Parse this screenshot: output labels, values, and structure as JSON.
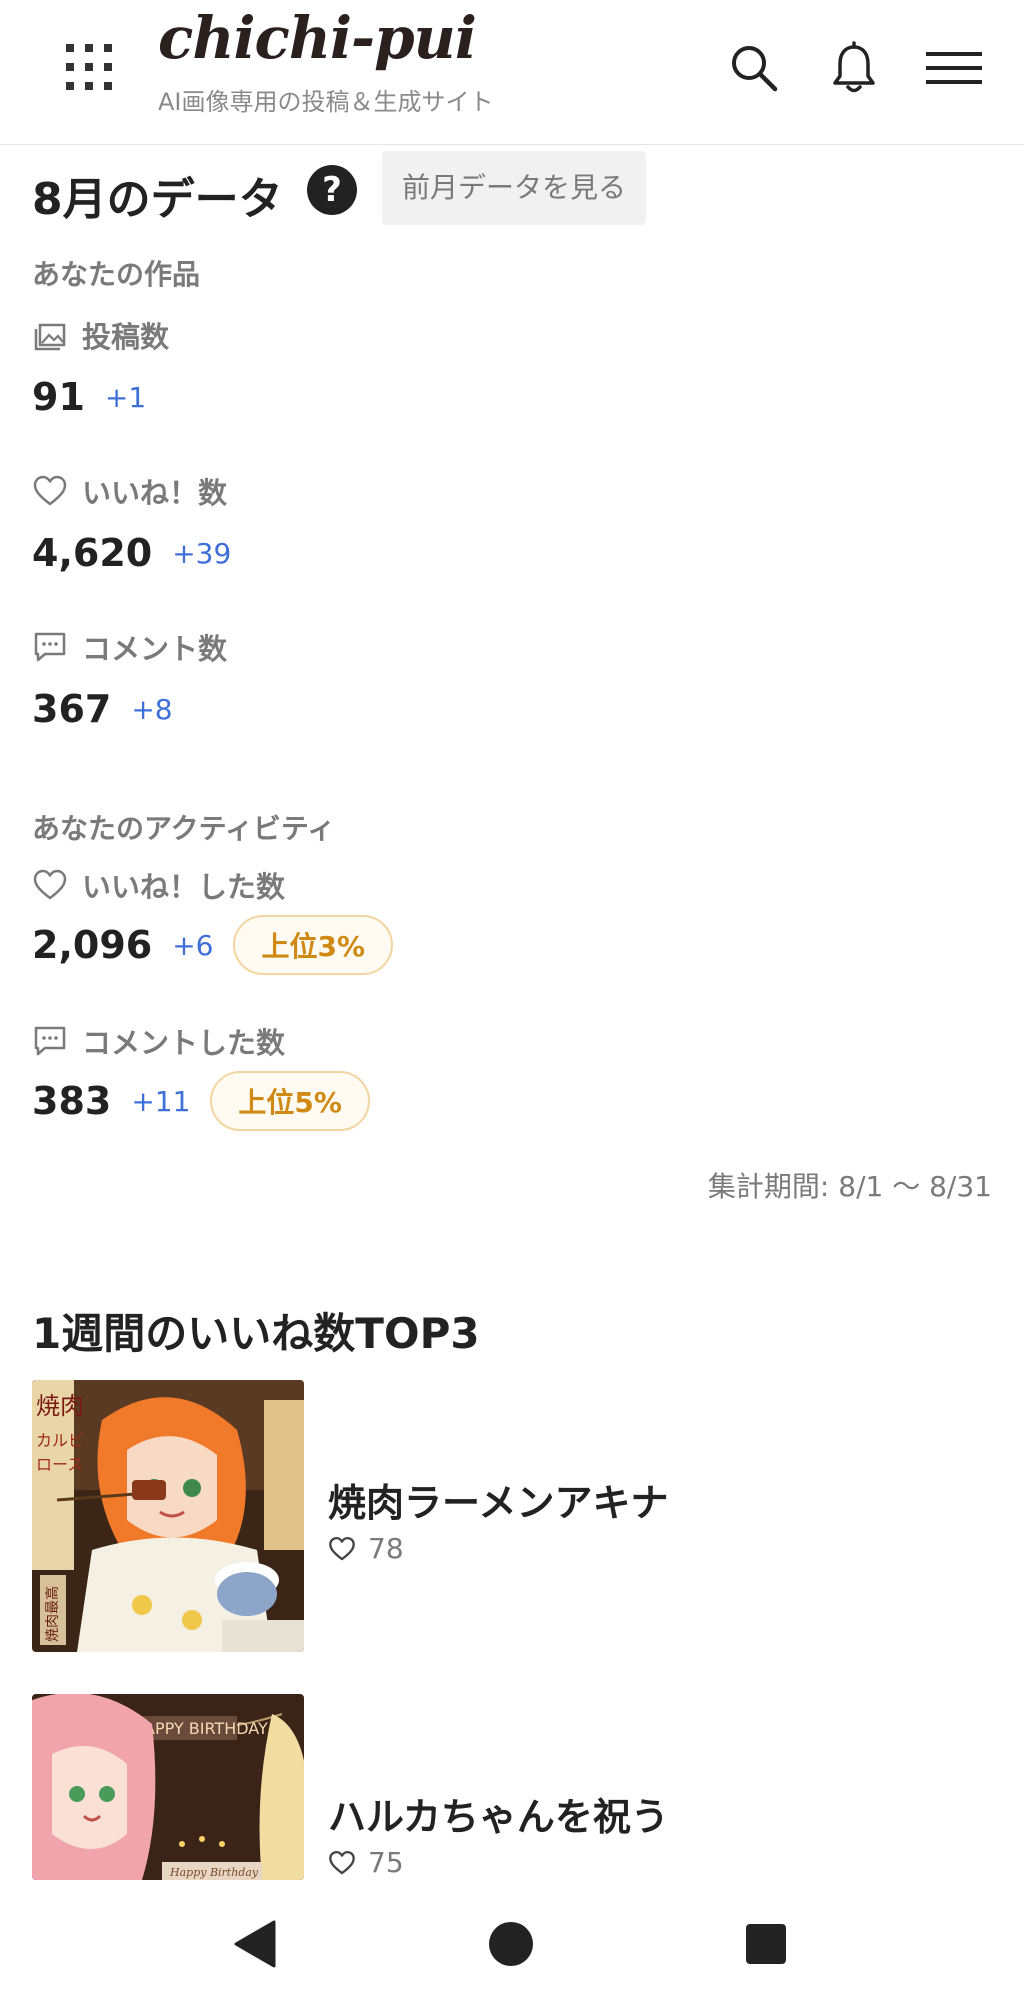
{
  "header": {
    "logo_text": "chichi-pui",
    "tagline": "AI画像専用の投稿＆生成サイト"
  },
  "stats": {
    "title": "8月のデータ",
    "help_label": "?",
    "prev_month_button": "前月データを見る",
    "works_section": {
      "heading": "あなたの作品",
      "items": [
        {
          "label": "投稿数",
          "value": "91",
          "diff": "+1"
        },
        {
          "label": "いいね！数",
          "value": "4,620",
          "diff": "+39"
        },
        {
          "label": "コメント数",
          "value": "367",
          "diff": "+8"
        }
      ]
    },
    "activity_section": {
      "heading": "あなたのアクティビティ",
      "items": [
        {
          "label": "いいね！した数",
          "value": "2,096",
          "diff": "+6",
          "rank": "上位3%"
        },
        {
          "label": "コメントした数",
          "value": "383",
          "diff": "+11",
          "rank": "上位5%"
        }
      ]
    },
    "period": "集計期間: 8/1 〜 8/31"
  },
  "top3": {
    "title": "1週間のいいね数TOP3",
    "works": [
      {
        "title": "焼肉ラーメンアキナ",
        "likes": "78"
      },
      {
        "title": "ハルカちゃんを祝う",
        "likes": "75"
      }
    ]
  },
  "images": {
    "work1_sign_top": "焼肉",
    "work1_sign_menu": "カルビ",
    "work1_sign_menu2": "ロース",
    "work1_sign_bottom": "焼肉最高",
    "work2_banner": "HAPPY BIRTHDAY",
    "work2_cake_text": "Happy Birthday"
  },
  "colors": {
    "accent_blue": "#3f6fd8",
    "rank_orange": "#d08a14",
    "muted_text": "#7a7a7a"
  },
  "icons": {
    "menu": "grid-menu-icon",
    "search": "search-icon",
    "bell": "bell-icon",
    "hamburger": "hamburger-icon",
    "posts": "image-stack-icon",
    "like": "heart-outline-icon",
    "comment": "comment-icon"
  }
}
